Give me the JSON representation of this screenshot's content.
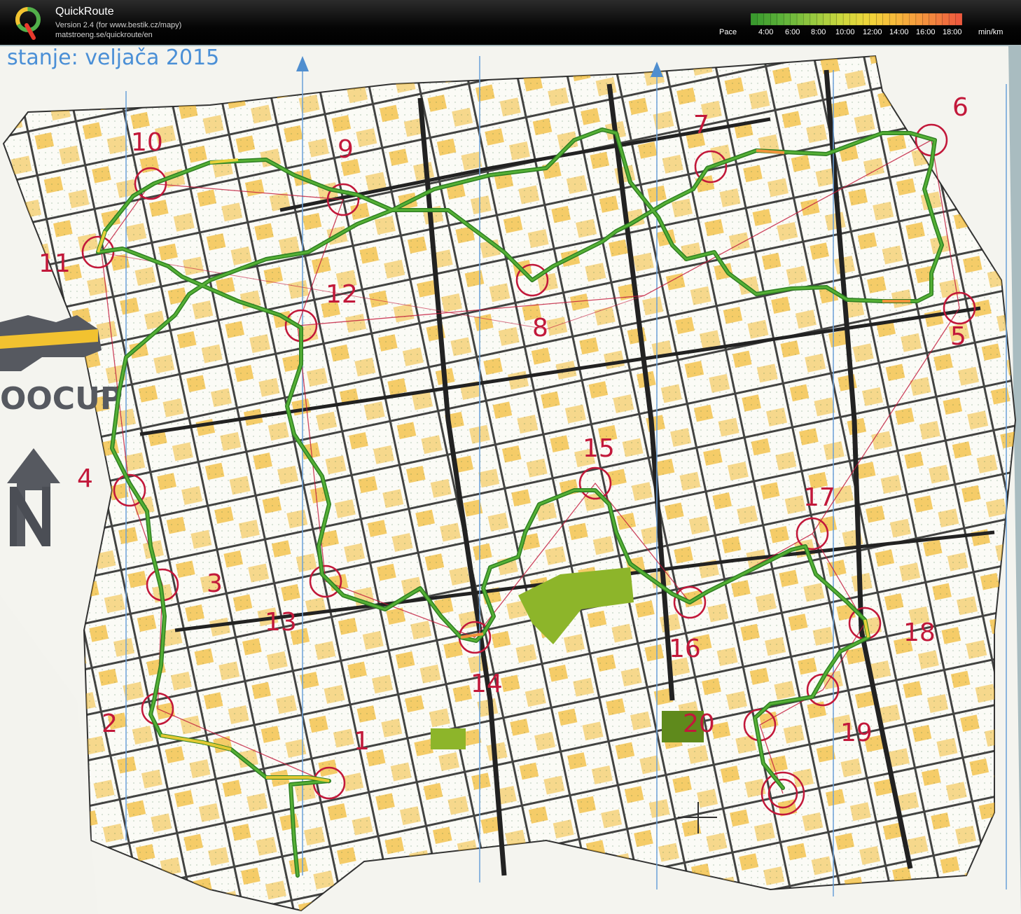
{
  "header": {
    "app_name": "QuickRoute",
    "logo_letter": "Q",
    "version_line": "Version 2.4  (for www.bestik.cz/mapy)",
    "url_line": "matstroeng.se/quickroute/en"
  },
  "pace_legend": {
    "label": "Pace",
    "ticks": [
      "4:00",
      "6:00",
      "8:00",
      "10:00",
      "12:00",
      "14:00",
      "16:00",
      "18:00"
    ],
    "unit": "min/km",
    "colors": [
      "#3a9a2e",
      "#5fb33a",
      "#95c83f",
      "#cdd83e",
      "#f2d43a",
      "#f7b33c",
      "#f48b3e",
      "#ee5a3e"
    ]
  },
  "map": {
    "header_text": "stanje: veljača 2015",
    "logo_text": "OOCUP",
    "colors": {
      "paper": "#f4f4ef",
      "open_land": "#f2b726",
      "route": "#3f9a2a",
      "course": "#c2183a",
      "road": "#2a2a2a",
      "green_area": "#8db52a"
    },
    "controls": [
      {
        "label": "1"
      },
      {
        "label": "2"
      },
      {
        "label": "3"
      },
      {
        "label": "4"
      },
      {
        "label": "5"
      },
      {
        "label": "6"
      },
      {
        "label": "7"
      },
      {
        "label": "8"
      },
      {
        "label": "9"
      },
      {
        "label": "10"
      },
      {
        "label": "11"
      },
      {
        "label": "12"
      },
      {
        "label": "13"
      },
      {
        "label": "14"
      },
      {
        "label": "15"
      },
      {
        "label": "16"
      },
      {
        "label": "17"
      },
      {
        "label": "18"
      },
      {
        "label": "19"
      },
      {
        "label": "20"
      }
    ]
  }
}
